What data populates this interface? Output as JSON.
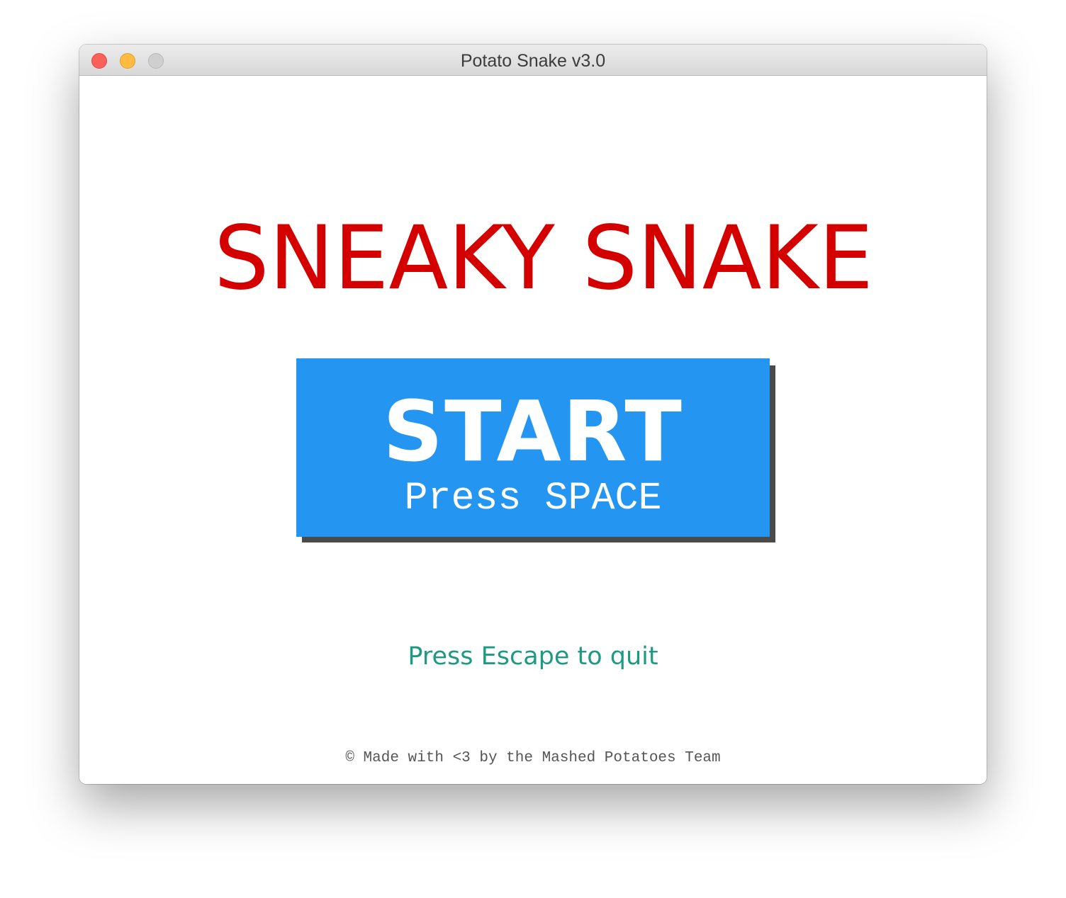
{
  "window": {
    "title": "Potato Snake v3.0"
  },
  "game": {
    "logo_text": "SNEAKY SNAKE",
    "start_button": {
      "label": "START",
      "hint": "Press SPACE"
    },
    "quit_hint": "Press Escape to quit",
    "footer": "© Made with <3 by the Mashed Potatoes Team"
  },
  "colors": {
    "logo": "#d40000",
    "button": "#2496f2",
    "button_shadow": "#4a4a4a",
    "quit_text": "#1f9a82",
    "footer_text": "#555555"
  }
}
